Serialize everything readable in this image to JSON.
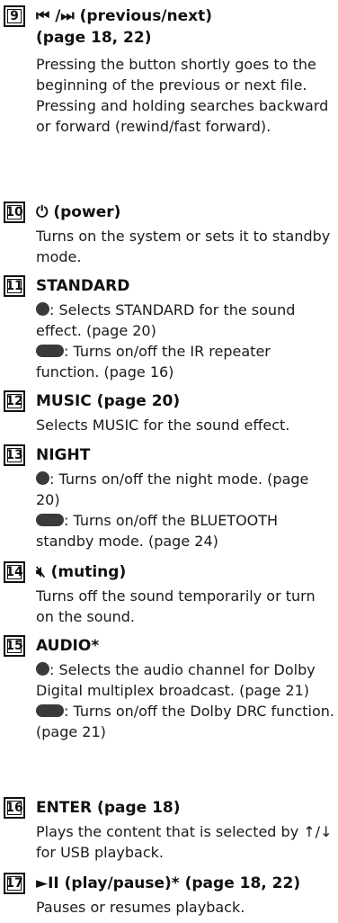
{
  "entries": [
    {
      "num": "9",
      "title_lines": [
        "⏮ /⏭ (previous/next)",
        "(page 18, 22)"
      ],
      "icon": "previous-next-icon",
      "paras": [
        "Pressing the button shortly goes to the beginning of the previous or next file.",
        "Pressing and holding searches backward or forward (rewind/fast forward)."
      ]
    },
    {
      "num": "10",
      "title": "⏻ (power)",
      "icon": "power-icon",
      "paras": [
        "Turns on the system or sets it to standby mode."
      ]
    },
    {
      "num": "11",
      "title": "STANDARD",
      "round_text": ": Selects STANDARD for the sound effect. (page 20)",
      "pill_text": ": Turns on/off the IR repeater function. (page 16)"
    },
    {
      "num": "12",
      "title": "MUSIC (page 20)",
      "paras": [
        "Selects MUSIC for the sound effect."
      ]
    },
    {
      "num": "13",
      "title": "NIGHT",
      "round_text": ": Turns on/off the night mode. (page 20)",
      "pill_text": ": Turns on/off the BLUETOOTH standby mode. (page 24)"
    },
    {
      "num": "14",
      "title": "🔇︎ (muting)",
      "icon": "muting-icon",
      "paras": [
        "Turns off the sound temporarily or turn on the sound."
      ]
    },
    {
      "num": "15",
      "title": "AUDIO*",
      "round_text": ": Selects the audio channel for Dolby Digital multiplex broadcast. (page 21)",
      "pill_text": ": Turns on/off the Dolby DRC function. (page 21)"
    },
    {
      "num": "16",
      "title": "ENTER (page 18)",
      "paras": [
        "Plays the content that is selected by ↑/↓ for USB playback."
      ]
    },
    {
      "num": "17",
      "title": "►II (play/pause)* (page 18, 22)",
      "icon": "play-pause-icon",
      "paras": [
        "Pauses or resumes playback."
      ]
    }
  ]
}
